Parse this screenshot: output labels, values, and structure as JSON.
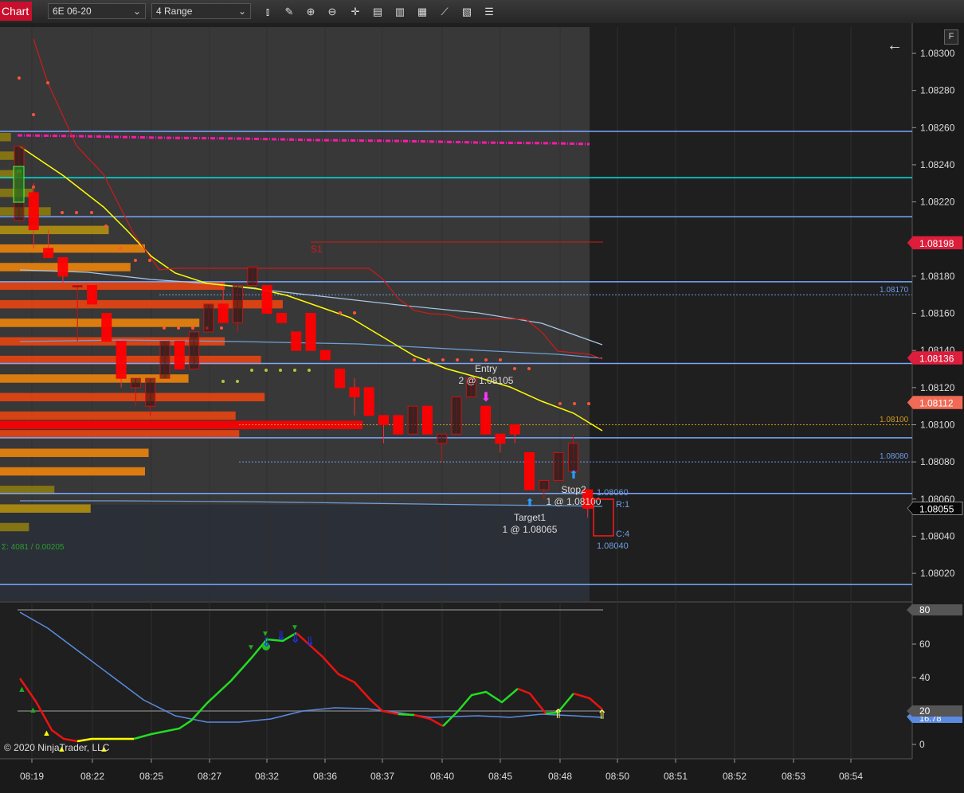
{
  "toolbar": {
    "chart_tab": "Chart",
    "instrument": "6E 06-20",
    "bar_type": "4 Range",
    "buttons": [
      "bar-type-icon",
      "draw-icon",
      "zoom-in-icon",
      "zoom-out-icon",
      "crosshair-icon",
      "properties-icon",
      "data-box-icon",
      "chart-trader-icon",
      "strategies-icon",
      "templates-icon",
      "list-icon"
    ]
  },
  "panel_label": "F",
  "price_axis": {
    "ticks": [
      "1.08300",
      "1.08280",
      "1.08260",
      "1.08240",
      "1.08220",
      "1.08180",
      "1.08160",
      "1.08140",
      "1.08120",
      "1.08100",
      "1.08080",
      "1.08060",
      "1.08040",
      "1.08020"
    ],
    "tags": [
      {
        "label": "1.08198",
        "color": "#dc1e3c"
      },
      {
        "label": "1.08136",
        "color": "#dc1e3c"
      },
      {
        "label": "1.08112",
        "color": "#f06a55"
      },
      {
        "label": "1.08055",
        "color": "#0a0a0a"
      }
    ]
  },
  "line_labels": [
    {
      "text": "1.08170",
      "color": "#6e9be6"
    },
    {
      "text": "1.08100",
      "color": "#d09a1a"
    },
    {
      "text": "1.08080",
      "color": "#6e9be6"
    }
  ],
  "pivot_label": "S1",
  "volume_profile_stats": "Σ: 4081 / 0.00205",
  "orders": {
    "entry": {
      "title": "Entry",
      "detail": "2 @ 1.08105"
    },
    "stop": {
      "title": "Stop2",
      "detail": "1 @ 1.08100"
    },
    "target": {
      "title": "Target1",
      "detail": "1 @ 1.08065"
    }
  },
  "range_box": {
    "high": "1.08060",
    "low": "1.08040",
    "r_label": "R:1",
    "c_label": "C:4"
  },
  "oscillator": {
    "ticks": [
      "60",
      "40",
      "20",
      "0"
    ],
    "tags": [
      {
        "label": "80"
      },
      {
        "label": "20"
      }
    ],
    "hidden_tag": "16.78",
    "overbought": 80,
    "oversold": 20
  },
  "time_axis": [
    "08:19",
    "08:22",
    "08:25",
    "08:27",
    "08:32",
    "08:36",
    "08:37",
    "08:40",
    "08:45",
    "08:48",
    "08:50",
    "08:51",
    "08:52",
    "08:53",
    "08:54"
  ],
  "back_arrow": "←",
  "copyright": "© 2020 NinjaTrader, LLC",
  "colors": {
    "up_candle": "#2a2a2a",
    "down_candle": "#ff0000",
    "yellow_ma": "#ffff00",
    "pivot_magenta": "#ff1aa8",
    "blue_line": "#7aa7ff",
    "cyan_line": "#00e5e5",
    "stoch_up": "#22dd22",
    "stoch_down": "#ee1111",
    "stoch_flat": "#ffff00"
  },
  "chart_data": {
    "type": "candlestick",
    "x_labels": [
      "08:19",
      "08:22",
      "08:25",
      "08:27",
      "08:32",
      "08:36",
      "08:37",
      "08:40",
      "08:45",
      "08:48",
      "08:50"
    ],
    "price_range": [
      1.0801,
      1.0831
    ],
    "candles": [
      {
        "o": 1.0821,
        "h": 1.0825,
        "l": 1.0821,
        "c": 1.0825
      },
      {
        "o": 1.08225,
        "h": 1.0823,
        "l": 1.08195,
        "c": 1.08205
      },
      {
        "o": 1.08195,
        "h": 1.08205,
        "l": 1.0819,
        "c": 1.0819
      },
      {
        "o": 1.0819,
        "h": 1.0819,
        "l": 1.08175,
        "c": 1.0818
      },
      {
        "o": 1.08175,
        "h": 1.08175,
        "l": 1.08145,
        "c": 1.08175
      },
      {
        "o": 1.08175,
        "h": 1.08175,
        "l": 1.08165,
        "c": 1.08165
      },
      {
        "o": 1.0816,
        "h": 1.0816,
        "l": 1.08145,
        "c": 1.08145
      },
      {
        "o": 1.08145,
        "h": 1.08145,
        "l": 1.0812,
        "c": 1.08125
      },
      {
        "o": 1.0812,
        "h": 1.08125,
        "l": 1.0811,
        "c": 1.08125
      },
      {
        "o": 1.0811,
        "h": 1.08125,
        "l": 1.08105,
        "c": 1.08125
      },
      {
        "o": 1.08125,
        "h": 1.08145,
        "l": 1.08125,
        "c": 1.08145
      },
      {
        "o": 1.08145,
        "h": 1.08145,
        "l": 1.0813,
        "c": 1.0813
      },
      {
        "o": 1.0813,
        "h": 1.0815,
        "l": 1.0813,
        "c": 1.0815
      },
      {
        "o": 1.0815,
        "h": 1.08165,
        "l": 1.0815,
        "c": 1.08165
      },
      {
        "o": 1.08165,
        "h": 1.08175,
        "l": 1.08155,
        "c": 1.08155
      },
      {
        "o": 1.08155,
        "h": 1.08175,
        "l": 1.0815,
        "c": 1.08175
      },
      {
        "o": 1.08175,
        "h": 1.08185,
        "l": 1.08175,
        "c": 1.08185
      },
      {
        "o": 1.08175,
        "h": 1.08175,
        "l": 1.0816,
        "c": 1.0816
      },
      {
        "o": 1.0816,
        "h": 1.0816,
        "l": 1.08155,
        "c": 1.08155
      },
      {
        "o": 1.0815,
        "h": 1.0815,
        "l": 1.0814,
        "c": 1.0814
      },
      {
        "o": 1.0816,
        "h": 1.0816,
        "l": 1.0814,
        "c": 1.0814
      },
      {
        "o": 1.0814,
        "h": 1.0814,
        "l": 1.08135,
        "c": 1.08135
      },
      {
        "o": 1.0813,
        "h": 1.0813,
        "l": 1.0812,
        "c": 1.0812
      },
      {
        "o": 1.0812,
        "h": 1.08125,
        "l": 1.08105,
        "c": 1.08115
      },
      {
        "o": 1.0812,
        "h": 1.0812,
        "l": 1.08105,
        "c": 1.08105
      },
      {
        "o": 1.08105,
        "h": 1.08105,
        "l": 1.0809,
        "c": 1.081
      },
      {
        "o": 1.08105,
        "h": 1.08105,
        "l": 1.08095,
        "c": 1.08095
      },
      {
        "o": 1.08095,
        "h": 1.0811,
        "l": 1.08095,
        "c": 1.0811
      },
      {
        "o": 1.0811,
        "h": 1.0811,
        "l": 1.08095,
        "c": 1.08095
      },
      {
        "o": 1.0809,
        "h": 1.08095,
        "l": 1.0808,
        "c": 1.08095
      },
      {
        "o": 1.08095,
        "h": 1.08115,
        "l": 1.08095,
        "c": 1.08115
      },
      {
        "o": 1.08115,
        "h": 1.08125,
        "l": 1.08115,
        "c": 1.08125
      },
      {
        "o": 1.0811,
        "h": 1.0811,
        "l": 1.08095,
        "c": 1.08095
      },
      {
        "o": 1.08095,
        "h": 1.08095,
        "l": 1.08085,
        "c": 1.0809
      },
      {
        "o": 1.081,
        "h": 1.081,
        "l": 1.0809,
        "c": 1.08095
      },
      {
        "o": 1.08085,
        "h": 1.08085,
        "l": 1.08065,
        "c": 1.08065
      },
      {
        "o": 1.08065,
        "h": 1.0807,
        "l": 1.0806,
        "c": 1.0807
      },
      {
        "o": 1.0807,
        "h": 1.08085,
        "l": 1.0807,
        "c": 1.08085
      },
      {
        "o": 1.08075,
        "h": 1.08095,
        "l": 1.08075,
        "c": 1.0809
      },
      {
        "o": 1.08065,
        "h": 1.08065,
        "l": 1.0805,
        "c": 1.08055
      }
    ],
    "horizontal_lines": [
      {
        "price": 1.08258,
        "color": "#7aa7ff"
      },
      {
        "price": 1.08233,
        "color": "#00e5e5"
      },
      {
        "price": 1.08212,
        "color": "#7aa7ff"
      },
      {
        "price": 1.08177,
        "color": "#7aa7ff"
      },
      {
        "price": 1.08133,
        "color": "#7aa7ff"
      },
      {
        "price": 1.08093,
        "color": "#7aa7ff"
      },
      {
        "price": 1.08063,
        "color": "#7aa7ff"
      },
      {
        "price": 1.08014,
        "color": "#7aa7ff"
      }
    ],
    "volume_profile": [
      {
        "p": 1.08255,
        "v": 0.03
      },
      {
        "p": 1.08245,
        "v": 0.04
      },
      {
        "p": 1.08235,
        "v": 0.06
      },
      {
        "p": 1.08225,
        "v": 0.09
      },
      {
        "p": 1.08215,
        "v": 0.14
      },
      {
        "p": 1.08205,
        "v": 0.3
      },
      {
        "p": 1.08195,
        "v": 0.4
      },
      {
        "p": 1.08185,
        "v": 0.36
      },
      {
        "p": 1.08175,
        "v": 0.62
      },
      {
        "p": 1.08165,
        "v": 0.78
      },
      {
        "p": 1.08155,
        "v": 0.55
      },
      {
        "p": 1.08145,
        "v": 0.62
      },
      {
        "p": 1.08135,
        "v": 0.72
      },
      {
        "p": 1.08125,
        "v": 0.52
      },
      {
        "p": 1.08115,
        "v": 0.73
      },
      {
        "p": 1.08105,
        "v": 0.65
      },
      {
        "p": 1.081,
        "v": 1.0
      },
      {
        "p": 1.08095,
        "v": 0.66
      },
      {
        "p": 1.08085,
        "v": 0.41
      },
      {
        "p": 1.08075,
        "v": 0.4
      },
      {
        "p": 1.08065,
        "v": 0.15
      },
      {
        "p": 1.08055,
        "v": 0.25
      },
      {
        "p": 1.08045,
        "v": 0.08
      }
    ],
    "oscillator_range": [
      0,
      85
    ]
  }
}
